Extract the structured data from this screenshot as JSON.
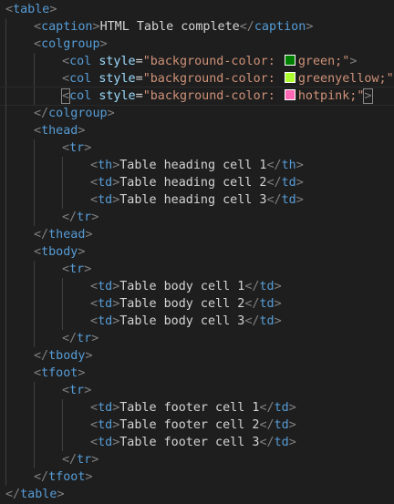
{
  "editor": {
    "lines": [
      {
        "indent": 0,
        "tokens": [
          [
            "punct",
            "<"
          ],
          [
            "tag",
            "table"
          ],
          [
            "punct",
            ">"
          ]
        ]
      },
      {
        "indent": 1,
        "tokens": [
          [
            "punct",
            "<"
          ],
          [
            "tag",
            "caption"
          ],
          [
            "punct",
            ">"
          ],
          [
            "txt",
            "HTML Table complete"
          ],
          [
            "punct",
            "</"
          ],
          [
            "tag",
            "caption"
          ],
          [
            "punct",
            ">"
          ]
        ]
      },
      {
        "indent": 1,
        "tokens": [
          [
            "punct",
            "<"
          ],
          [
            "tag",
            "colgroup"
          ],
          [
            "punct",
            ">"
          ]
        ]
      },
      {
        "indent": 2,
        "tokens": [
          [
            "punct",
            "<"
          ],
          [
            "tag",
            "col"
          ],
          [
            "txt",
            " "
          ],
          [
            "attr",
            "style"
          ],
          [
            "eq",
            "="
          ],
          [
            "str",
            "\"background-color: "
          ],
          [
            "swatch",
            "#008000"
          ],
          [
            "str",
            "green;\""
          ],
          [
            "punct",
            ">"
          ]
        ]
      },
      {
        "indent": 2,
        "tokens": [
          [
            "punct",
            "<"
          ],
          [
            "tag",
            "col"
          ],
          [
            "txt",
            " "
          ],
          [
            "attr",
            "style"
          ],
          [
            "eq",
            "="
          ],
          [
            "str",
            "\"background-color: "
          ],
          [
            "swatch",
            "#adff2f"
          ],
          [
            "str",
            "greenyellow;\""
          ],
          [
            "punct",
            ">"
          ]
        ]
      },
      {
        "indent": 2,
        "active": true,
        "tokens": [
          [
            "punct-match",
            "<"
          ],
          [
            "tag",
            "col"
          ],
          [
            "txt",
            " "
          ],
          [
            "attr",
            "style"
          ],
          [
            "eq",
            "="
          ],
          [
            "str",
            "\"background-color: "
          ],
          [
            "swatch",
            "#ff69b4"
          ],
          [
            "str",
            "hotpink;\""
          ],
          [
            "punct-match",
            ">"
          ]
        ]
      },
      {
        "indent": 1,
        "tokens": [
          [
            "punct",
            "</"
          ],
          [
            "tag",
            "colgroup"
          ],
          [
            "punct",
            ">"
          ]
        ]
      },
      {
        "indent": 1,
        "tokens": [
          [
            "punct",
            "<"
          ],
          [
            "tag",
            "thead"
          ],
          [
            "punct",
            ">"
          ]
        ]
      },
      {
        "indent": 2,
        "tokens": [
          [
            "punct",
            "<"
          ],
          [
            "tag",
            "tr"
          ],
          [
            "punct",
            ">"
          ]
        ]
      },
      {
        "indent": 3,
        "tokens": [
          [
            "punct",
            "<"
          ],
          [
            "tag",
            "th"
          ],
          [
            "punct",
            ">"
          ],
          [
            "txt",
            "Table heading cell 1"
          ],
          [
            "punct",
            "</"
          ],
          [
            "tag",
            "th"
          ],
          [
            "punct",
            ">"
          ]
        ]
      },
      {
        "indent": 3,
        "tokens": [
          [
            "punct",
            "<"
          ],
          [
            "tag",
            "td"
          ],
          [
            "punct",
            ">"
          ],
          [
            "txt",
            "Table heading cell 2"
          ],
          [
            "punct",
            "</"
          ],
          [
            "tag",
            "td"
          ],
          [
            "punct",
            ">"
          ]
        ]
      },
      {
        "indent": 3,
        "tokens": [
          [
            "punct",
            "<"
          ],
          [
            "tag",
            "td"
          ],
          [
            "punct",
            ">"
          ],
          [
            "txt",
            "Table heading cell 3"
          ],
          [
            "punct",
            "</"
          ],
          [
            "tag",
            "td"
          ],
          [
            "punct",
            ">"
          ]
        ]
      },
      {
        "indent": 2,
        "tokens": [
          [
            "punct",
            "</"
          ],
          [
            "tag",
            "tr"
          ],
          [
            "punct",
            ">"
          ]
        ]
      },
      {
        "indent": 1,
        "tokens": [
          [
            "punct",
            "</"
          ],
          [
            "tag",
            "thead"
          ],
          [
            "punct",
            ">"
          ]
        ]
      },
      {
        "indent": 1,
        "tokens": [
          [
            "punct",
            "<"
          ],
          [
            "tag",
            "tbody"
          ],
          [
            "punct",
            ">"
          ]
        ]
      },
      {
        "indent": 2,
        "tokens": [
          [
            "punct",
            "<"
          ],
          [
            "tag",
            "tr"
          ],
          [
            "punct",
            ">"
          ]
        ]
      },
      {
        "indent": 3,
        "tokens": [
          [
            "punct",
            "<"
          ],
          [
            "tag",
            "td"
          ],
          [
            "punct",
            ">"
          ],
          [
            "txt",
            "Table body cell 1"
          ],
          [
            "punct",
            "</"
          ],
          [
            "tag",
            "td"
          ],
          [
            "punct",
            ">"
          ]
        ]
      },
      {
        "indent": 3,
        "tokens": [
          [
            "punct",
            "<"
          ],
          [
            "tag",
            "td"
          ],
          [
            "punct",
            ">"
          ],
          [
            "txt",
            "Table body cell 2"
          ],
          [
            "punct",
            "</"
          ],
          [
            "tag",
            "td"
          ],
          [
            "punct",
            ">"
          ]
        ]
      },
      {
        "indent": 3,
        "tokens": [
          [
            "punct",
            "<"
          ],
          [
            "tag",
            "td"
          ],
          [
            "punct",
            ">"
          ],
          [
            "txt",
            "Table body cell 3"
          ],
          [
            "punct",
            "</"
          ],
          [
            "tag",
            "td"
          ],
          [
            "punct",
            ">"
          ]
        ]
      },
      {
        "indent": 2,
        "tokens": [
          [
            "punct",
            "</"
          ],
          [
            "tag",
            "tr"
          ],
          [
            "punct",
            ">"
          ]
        ]
      },
      {
        "indent": 1,
        "tokens": [
          [
            "punct",
            "</"
          ],
          [
            "tag",
            "tbody"
          ],
          [
            "punct",
            ">"
          ]
        ]
      },
      {
        "indent": 1,
        "tokens": [
          [
            "punct",
            "<"
          ],
          [
            "tag",
            "tfoot"
          ],
          [
            "punct",
            ">"
          ]
        ]
      },
      {
        "indent": 2,
        "tokens": [
          [
            "punct",
            "<"
          ],
          [
            "tag",
            "tr"
          ],
          [
            "punct",
            ">"
          ]
        ]
      },
      {
        "indent": 3,
        "tokens": [
          [
            "punct",
            "<"
          ],
          [
            "tag",
            "td"
          ],
          [
            "punct",
            ">"
          ],
          [
            "txt",
            "Table footer cell 1"
          ],
          [
            "punct",
            "</"
          ],
          [
            "tag",
            "td"
          ],
          [
            "punct",
            ">"
          ]
        ]
      },
      {
        "indent": 3,
        "tokens": [
          [
            "punct",
            "<"
          ],
          [
            "tag",
            "td"
          ],
          [
            "punct",
            ">"
          ],
          [
            "txt",
            "Table footer cell 2"
          ],
          [
            "punct",
            "</"
          ],
          [
            "tag",
            "td"
          ],
          [
            "punct",
            ">"
          ]
        ]
      },
      {
        "indent": 3,
        "tokens": [
          [
            "punct",
            "<"
          ],
          [
            "tag",
            "td"
          ],
          [
            "punct",
            ">"
          ],
          [
            "txt",
            "Table footer cell 3"
          ],
          [
            "punct",
            "</"
          ],
          [
            "tag",
            "td"
          ],
          [
            "punct",
            ">"
          ]
        ]
      },
      {
        "indent": 2,
        "tokens": [
          [
            "punct",
            "</"
          ],
          [
            "tag",
            "tr"
          ],
          [
            "punct",
            ">"
          ]
        ]
      },
      {
        "indent": 1,
        "tokens": [
          [
            "punct",
            "</"
          ],
          [
            "tag",
            "tfoot"
          ],
          [
            "punct",
            ">"
          ]
        ]
      },
      {
        "indent": 0,
        "tokens": [
          [
            "punct",
            "</"
          ],
          [
            "tag",
            "table"
          ],
          [
            "punct",
            ">"
          ]
        ]
      }
    ]
  }
}
